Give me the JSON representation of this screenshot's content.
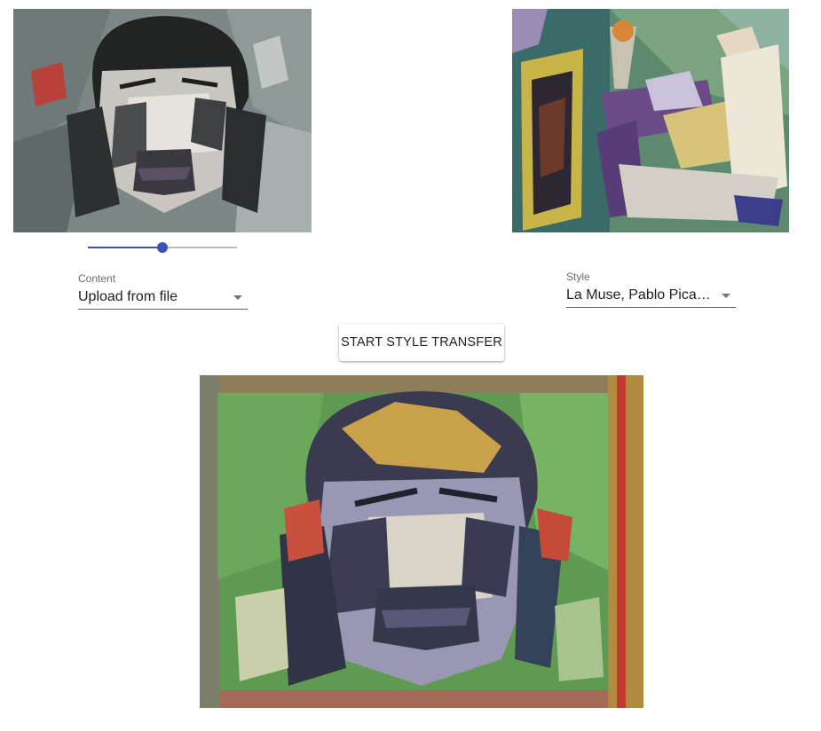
{
  "content": {
    "label": "Content",
    "selected": "Upload from file",
    "size_ratio": 0.5
  },
  "style": {
    "label": "Style",
    "selected": "La Muse, Pablo Picasso"
  },
  "actions": {
    "start_label": "START STYLE TRANSFER"
  },
  "colors": {
    "accent": "#3f51b5",
    "underline": "#5f5f5f",
    "label_text": "#6b6b6b"
  }
}
